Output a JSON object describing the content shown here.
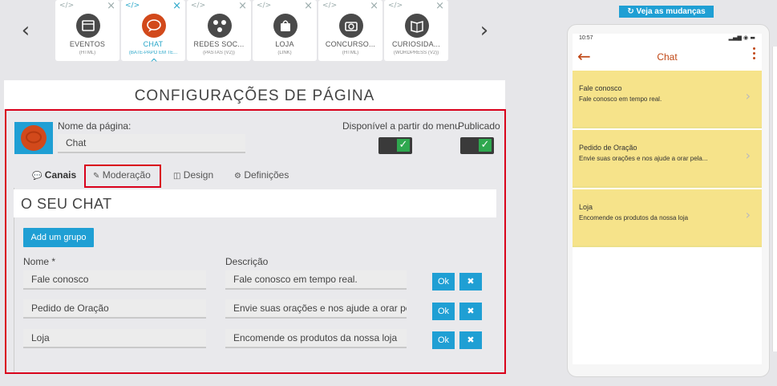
{
  "carousel": {
    "cards": [
      {
        "name": "EVENTOS",
        "sub": "(HTML)",
        "active": false
      },
      {
        "name": "CHAT",
        "sub": "(BATE-PAPO EM TE...",
        "active": true
      },
      {
        "name": "REDES SOC...",
        "sub": "(PASTAS (V2))",
        "active": false
      },
      {
        "name": "LOJA",
        "sub": "(LINK)",
        "active": false
      },
      {
        "name": "CONCURSO...",
        "sub": "(HTML)",
        "active": false
      },
      {
        "name": "CURIOSIDA...",
        "sub": "(WORDPRESS (V2))",
        "active": false
      }
    ]
  },
  "config": {
    "title": "CONFIGURAÇÕES DE PÁGINA",
    "page_name_label": "Nome da página:",
    "page_name_value": "Chat",
    "menu_label": "Disponível a partir do menu",
    "published_label": "Publicado",
    "tabs": [
      "Canais",
      "Moderação",
      "Design",
      "Definições"
    ],
    "chat_title": "O SEU CHAT",
    "add_group": "Add um grupo",
    "col_name": "Nome *",
    "col_desc": "Descrição",
    "ok_label": "Ok",
    "delete_label": "✖",
    "rows": [
      {
        "name": "Fale conosco",
        "desc": "Fale conosco em tempo real."
      },
      {
        "name": "Pedido de Oração",
        "desc": "Envie suas orações e nos ajude a orar pela"
      },
      {
        "name": "Loja",
        "desc": "Encomende os produtos da nossa loja"
      }
    ]
  },
  "preview": {
    "changes_button": "Veja as mudanças",
    "time": "10:57",
    "app_title": "Chat",
    "items": [
      {
        "name": "Fale conosco",
        "desc": "Fale conosco em tempo real."
      },
      {
        "name": "Pedido de Oração",
        "desc": "Envie suas orações e nos ajude a orar pela..."
      },
      {
        "name": "Loja",
        "desc": "Encomende os produtos da nossa loja"
      }
    ]
  },
  "colors": {
    "accent": "#1f9fd4",
    "active_tab": "#2aa7c9",
    "highlight": "#d9001b",
    "preview_item": "#f6e38a",
    "app_accent": "#c04715"
  }
}
